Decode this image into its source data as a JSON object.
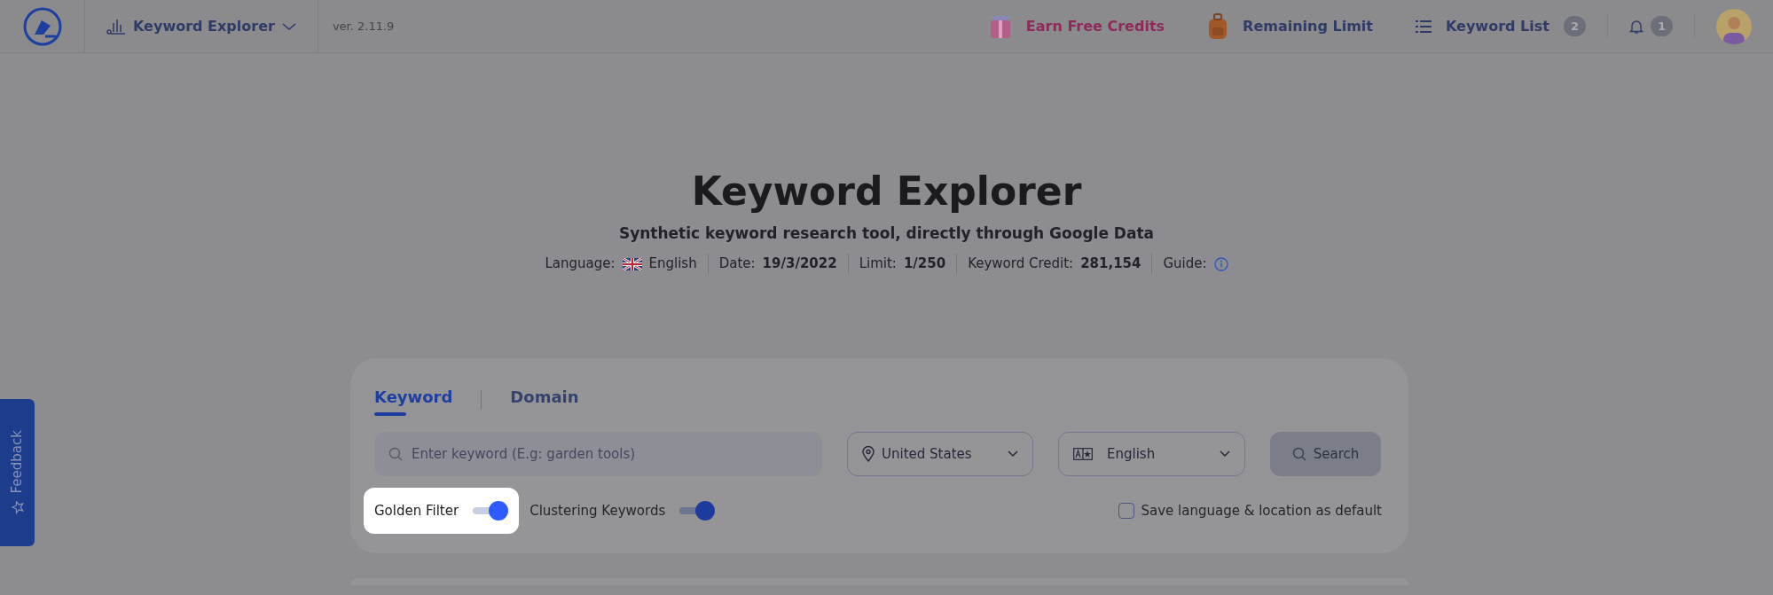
{
  "header": {
    "app_name": "Keyword Explorer",
    "version": "ver. 2.11.9",
    "links": [
      {
        "kind": "credits",
        "label": "Earn Free Credits"
      },
      {
        "kind": "limit",
        "label": "Remaining Limit"
      },
      {
        "kind": "list",
        "label": "Keyword List",
        "count": "2"
      }
    ],
    "notifications": {
      "count": "1"
    }
  },
  "hero": {
    "title": "Keyword Explorer",
    "subtitle": "Synthetic keyword research tool, directly through Google Data",
    "meta": [
      {
        "kind": "flag",
        "label": "Language:",
        "value": "English"
      },
      {
        "kind": "text",
        "label": "Date:",
        "value": "19/3/2022"
      },
      {
        "kind": "text",
        "label": "Limit:",
        "value": "1/250"
      },
      {
        "kind": "text",
        "label": "Keyword Credit:",
        "value": "281,154"
      },
      {
        "kind": "info",
        "label": "Guide:"
      }
    ]
  },
  "search_card": {
    "tabs": [
      {
        "label": "Keyword",
        "selected": true
      },
      {
        "label": "Domain",
        "selected": false
      }
    ],
    "keyword_field": {
      "placeholder": "Enter keyword (E.g: garden tools)"
    },
    "location": "United States",
    "language": "English",
    "search_button": {
      "label": "Search",
      "disabled": true
    },
    "toggles": [
      {
        "label": "Golden Filter",
        "on": true,
        "highlighted": true
      },
      {
        "label": "Clustering Keywords",
        "on": true,
        "highlighted": false
      }
    ],
    "save_default": {
      "label": "Save language & location as default",
      "checked": false
    }
  },
  "feedback": {
    "label": "Feedback"
  }
}
